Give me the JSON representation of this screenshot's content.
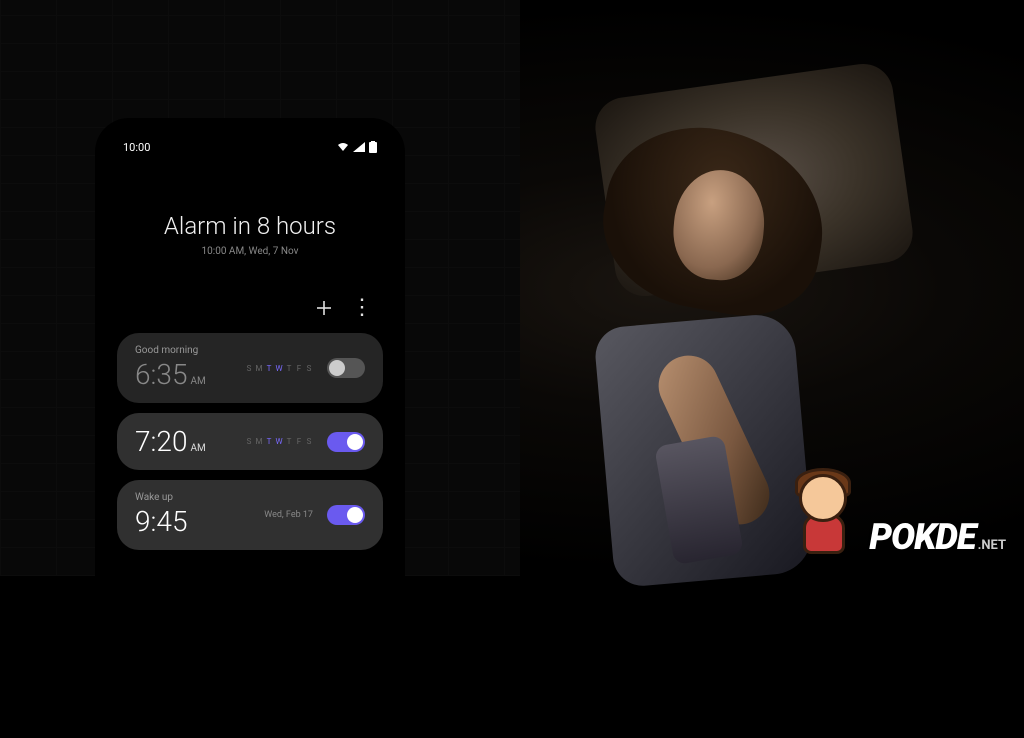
{
  "status_bar": {
    "time": "10:00",
    "icons": {
      "wifi": "wifi-icon",
      "signal": "signal-icon",
      "battery": "battery-icon"
    }
  },
  "header": {
    "title": "Alarm in 8 hours",
    "subtitle": "10:00 AM, Wed, 7 Nov"
  },
  "actions": {
    "add": "+",
    "more": "⋮"
  },
  "days_template": [
    "S",
    "M",
    "T",
    "W",
    "T",
    "F",
    "S"
  ],
  "alarms": [
    {
      "label": "Good morning",
      "time": "6:35",
      "ampm": "AM",
      "days_active": [
        false,
        false,
        true,
        true,
        false,
        false,
        false
      ],
      "enabled": false
    },
    {
      "label": "",
      "time": "7:20",
      "ampm": "AM",
      "days_active": [
        false,
        false,
        true,
        true,
        false,
        false,
        false
      ],
      "enabled": true
    },
    {
      "label": "Wake up",
      "time": "9:45",
      "ampm": "",
      "date": "Wed, Feb 17",
      "enabled": true
    }
  ],
  "watermark": {
    "brand": "POKDE",
    "tld": ".NET"
  }
}
